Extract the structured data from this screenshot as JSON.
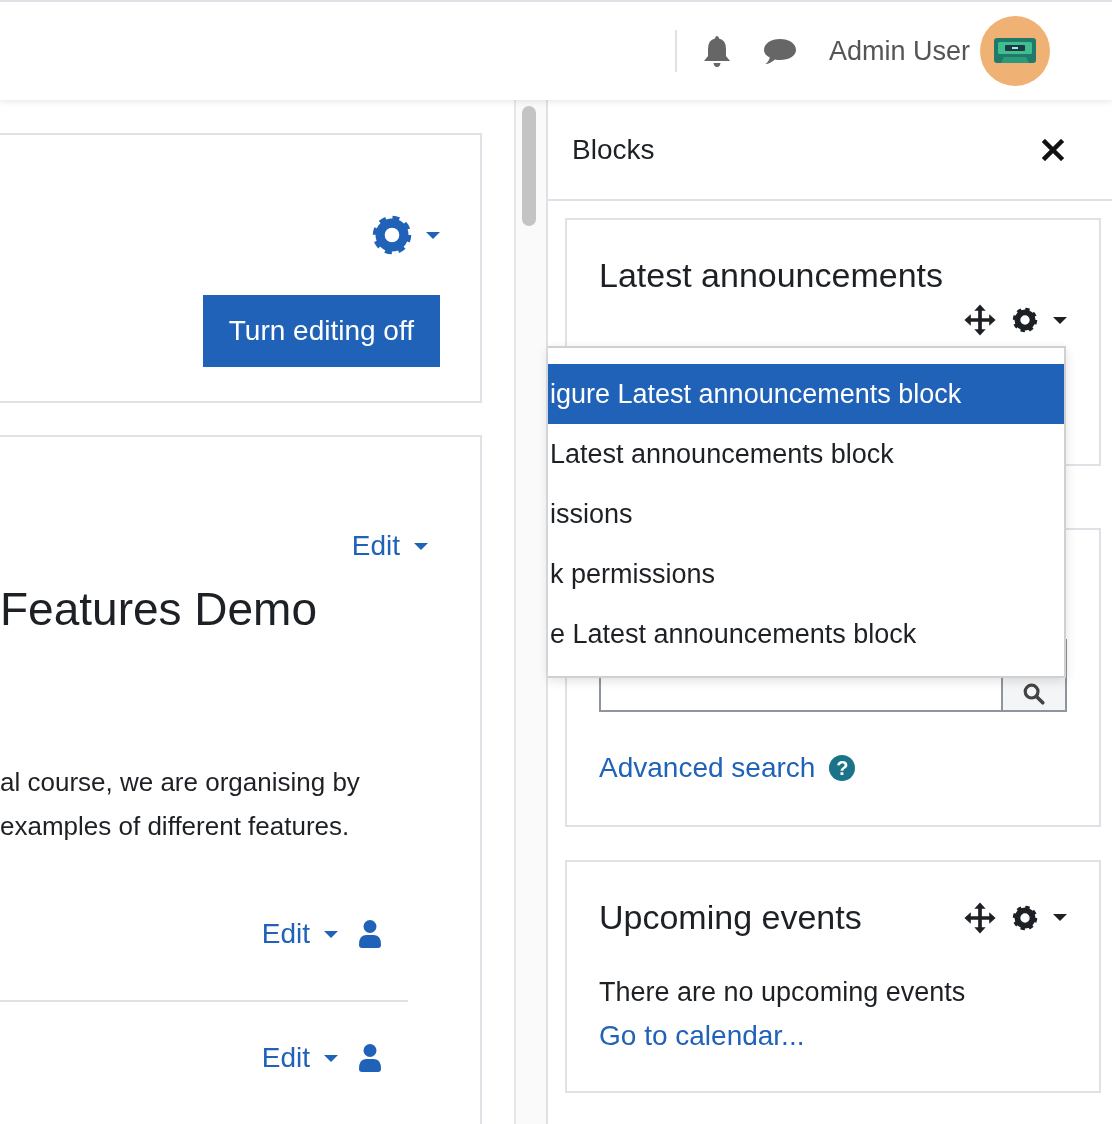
{
  "header": {
    "user_name": "Admin User"
  },
  "course_header": {
    "edit_button": "Turn editing off"
  },
  "section": {
    "edit_label": "Edit",
    "title": "Features Demo",
    "summary": "al course, we are organising by\nexamples of different features.",
    "activities": [
      {
        "edit_label": "Edit"
      },
      {
        "edit_label": "Edit"
      }
    ]
  },
  "drawer": {
    "title": "Blocks",
    "blocks": [
      {
        "kind": "announcements",
        "title": "Latest announcements"
      },
      {
        "kind": "search",
        "link": "Advanced search",
        "help": "?"
      },
      {
        "kind": "events",
        "title": "Upcoming events",
        "message": "There are no upcoming events",
        "link": "Go to calendar..."
      }
    ]
  },
  "block_menu": {
    "items": [
      {
        "label": "igure Latest announcements block",
        "selected": true
      },
      {
        "label": "Latest announcements block",
        "selected": false
      },
      {
        "label": "issions",
        "selected": false
      },
      {
        "label": "k permissions",
        "selected": false
      },
      {
        "label": "e Latest announcements block",
        "selected": false
      }
    ]
  }
}
